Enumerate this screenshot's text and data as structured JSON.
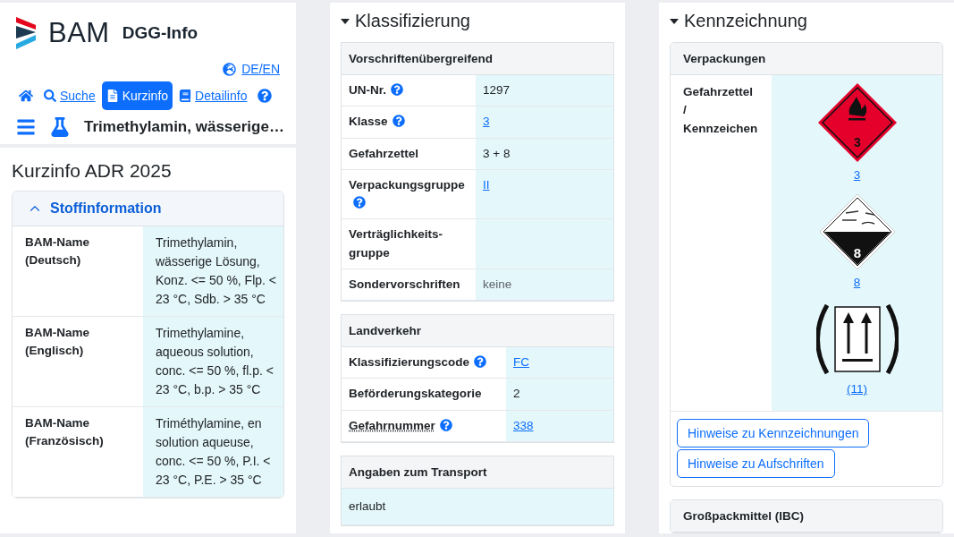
{
  "header": {
    "logo_text": "BAM",
    "app_name": "DGG-Info",
    "language": "DE/EN",
    "substance_title": "Trimethylamin, wässerige…"
  },
  "nav": [
    {
      "kind": "home",
      "selected": false
    },
    {
      "kind": "search",
      "label": "Suche",
      "selected": false
    },
    {
      "kind": "document",
      "label": "Kurzinfo",
      "selected": true
    },
    {
      "kind": "book",
      "label": "Detailinfo",
      "selected": false
    },
    {
      "kind": "help",
      "selected": false
    }
  ],
  "kurzinfo": {
    "title": "Kurzinfo ADR 2025",
    "section": {
      "title": "Stoffinformation",
      "expanded": true,
      "rows": [
        {
          "label": "BAM-Name (Deutsch)",
          "value": "Trimethylamin, wässerige Lösung, Konz. <= 50 %, Flp. < 23 °C, Sdb. > 35 °C"
        },
        {
          "label": "BAM-Name (Englisch)",
          "value": "Trimethylamine, aqueous solution, conc. <= 50 %, fl.p. < 23 °C, b.p. > 35 °C"
        },
        {
          "label": "BAM-Name (Französisch)",
          "value": "Triméthylamine, en solution aqueuse, conc. <= 50 %, P.I. < 23 °C, P.E. > 35 °C"
        }
      ]
    }
  },
  "klassifizierung": {
    "title": "Klassifizierung",
    "expanded": true,
    "groups": [
      {
        "title": "Vorschriftenübergreifend",
        "rows": [
          {
            "label": "UN-Nr.",
            "help": true,
            "value": "1297",
            "link": false
          },
          {
            "label": "Klasse",
            "help": true,
            "value": "3",
            "link": true
          },
          {
            "label": "Gefahrzettel",
            "help": false,
            "value": "3 + 8",
            "link": false
          },
          {
            "label": "Verpackungsgruppe",
            "help": true,
            "value": "II",
            "link": true
          },
          {
            "label": "Verträglichkeits-gruppe",
            "help": false
          },
          {
            "label": "Sondervorschriften",
            "help": false,
            "value": "keine",
            "link": false,
            "muted": true
          }
        ]
      },
      {
        "title": "Landverkehr",
        "rows": [
          {
            "label": "Klassifizierungscode",
            "help": true,
            "value": "FC",
            "link": true
          },
          {
            "label": "Beförderungskategorie",
            "help": false,
            "value": "2",
            "link": false
          },
          {
            "label": "Gefahrnummer",
            "help": true,
            "value": "338",
            "link": true,
            "abbr": true
          }
        ]
      },
      {
        "title": "Angaben zum Transport",
        "text": "erlaubt"
      }
    ]
  },
  "kennzeichnung": {
    "title": "Kennzeichnung",
    "expanded": true,
    "groups": [
      {
        "title": "Verpackungen",
        "label": "Gefahrzettel / Kennzeichen",
        "labels": [
          {
            "kind": "class3",
            "number": "3",
            "caption": "3"
          },
          {
            "kind": "class8",
            "number": "8",
            "caption": "8"
          },
          {
            "kind": "orientation",
            "caption": "(11)"
          }
        ],
        "buttons": [
          "Hinweise zu Kennzeichnungen",
          "Hinweise zu Aufschriften"
        ]
      },
      {
        "title": "Großpackmittel (IBC)"
      }
    ]
  }
}
